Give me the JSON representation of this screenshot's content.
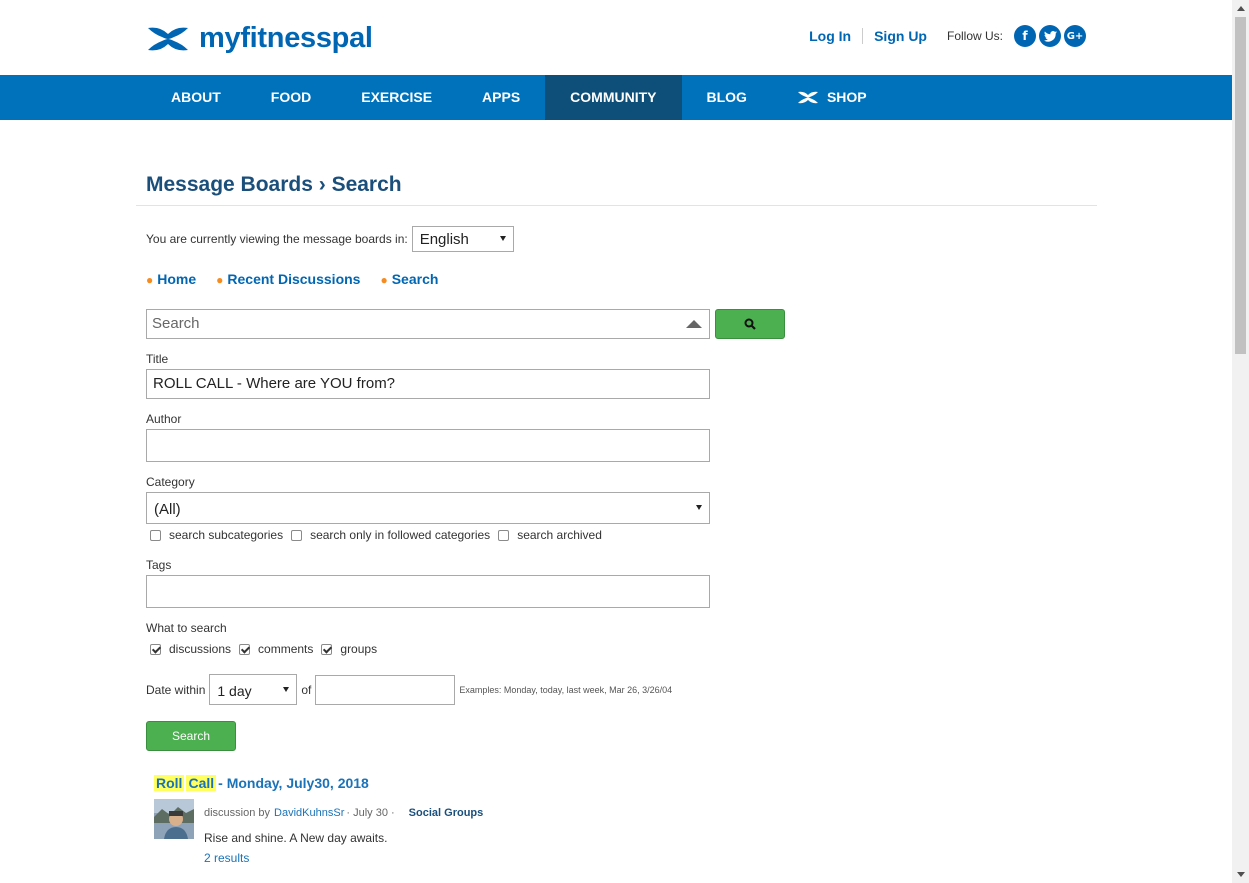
{
  "brand": {
    "name": "myfitnesspal",
    "color": "#0066b3"
  },
  "top_links": {
    "login": "Log In",
    "signup": "Sign Up",
    "follow": "Follow Us:"
  },
  "social": {
    "facebook": "f",
    "twitter": "t",
    "google": "G+"
  },
  "nav": {
    "items": [
      {
        "label": "ABOUT"
      },
      {
        "label": "FOOD"
      },
      {
        "label": "EXERCISE"
      },
      {
        "label": "APPS"
      },
      {
        "label": "COMMUNITY",
        "active": true
      },
      {
        "label": "BLOG"
      },
      {
        "label": "SHOP"
      }
    ],
    "color": "#0072bc",
    "active_color": "#0e4f7a"
  },
  "page": {
    "title": "Message Boards › Search"
  },
  "language": {
    "label": "You are currently viewing the message boards in:",
    "selected": "English"
  },
  "breadcrumbs": [
    "Home",
    "Recent Discussions",
    "Search"
  ],
  "search": {
    "placeholder": "Search"
  },
  "form": {
    "title_label": "Title",
    "title_value": "ROLL CALL - Where are YOU from?",
    "author_label": "Author",
    "author_value": "",
    "category_label": "Category",
    "category_selected": "(All)",
    "cat_options": [
      {
        "label": "search subcategories",
        "checked": false
      },
      {
        "label": "search only in followed categories",
        "checked": false
      },
      {
        "label": "search archived",
        "checked": false
      }
    ],
    "tags_label": "Tags",
    "what_label": "What to search",
    "what_options": [
      {
        "label": "discussions",
        "checked": true
      },
      {
        "label": "comments",
        "checked": true
      },
      {
        "label": "groups",
        "checked": true
      }
    ],
    "date_label": "Date within",
    "date_selected": "1 day",
    "date_of": "of",
    "date_examples": "Examples: Monday, today, last week, Mar 26, 3/26/04",
    "submit": "Search"
  },
  "result": {
    "hl1": "Roll",
    "hl2": "Call",
    "title_rest": " - Monday, July30, 2018",
    "type": "discussion by",
    "author": "DavidKuhnsSr",
    "date": "· July 30 ·",
    "group": "Social Groups",
    "excerpt": "Rise and shine. A New day awaits.",
    "count": "2 results"
  }
}
